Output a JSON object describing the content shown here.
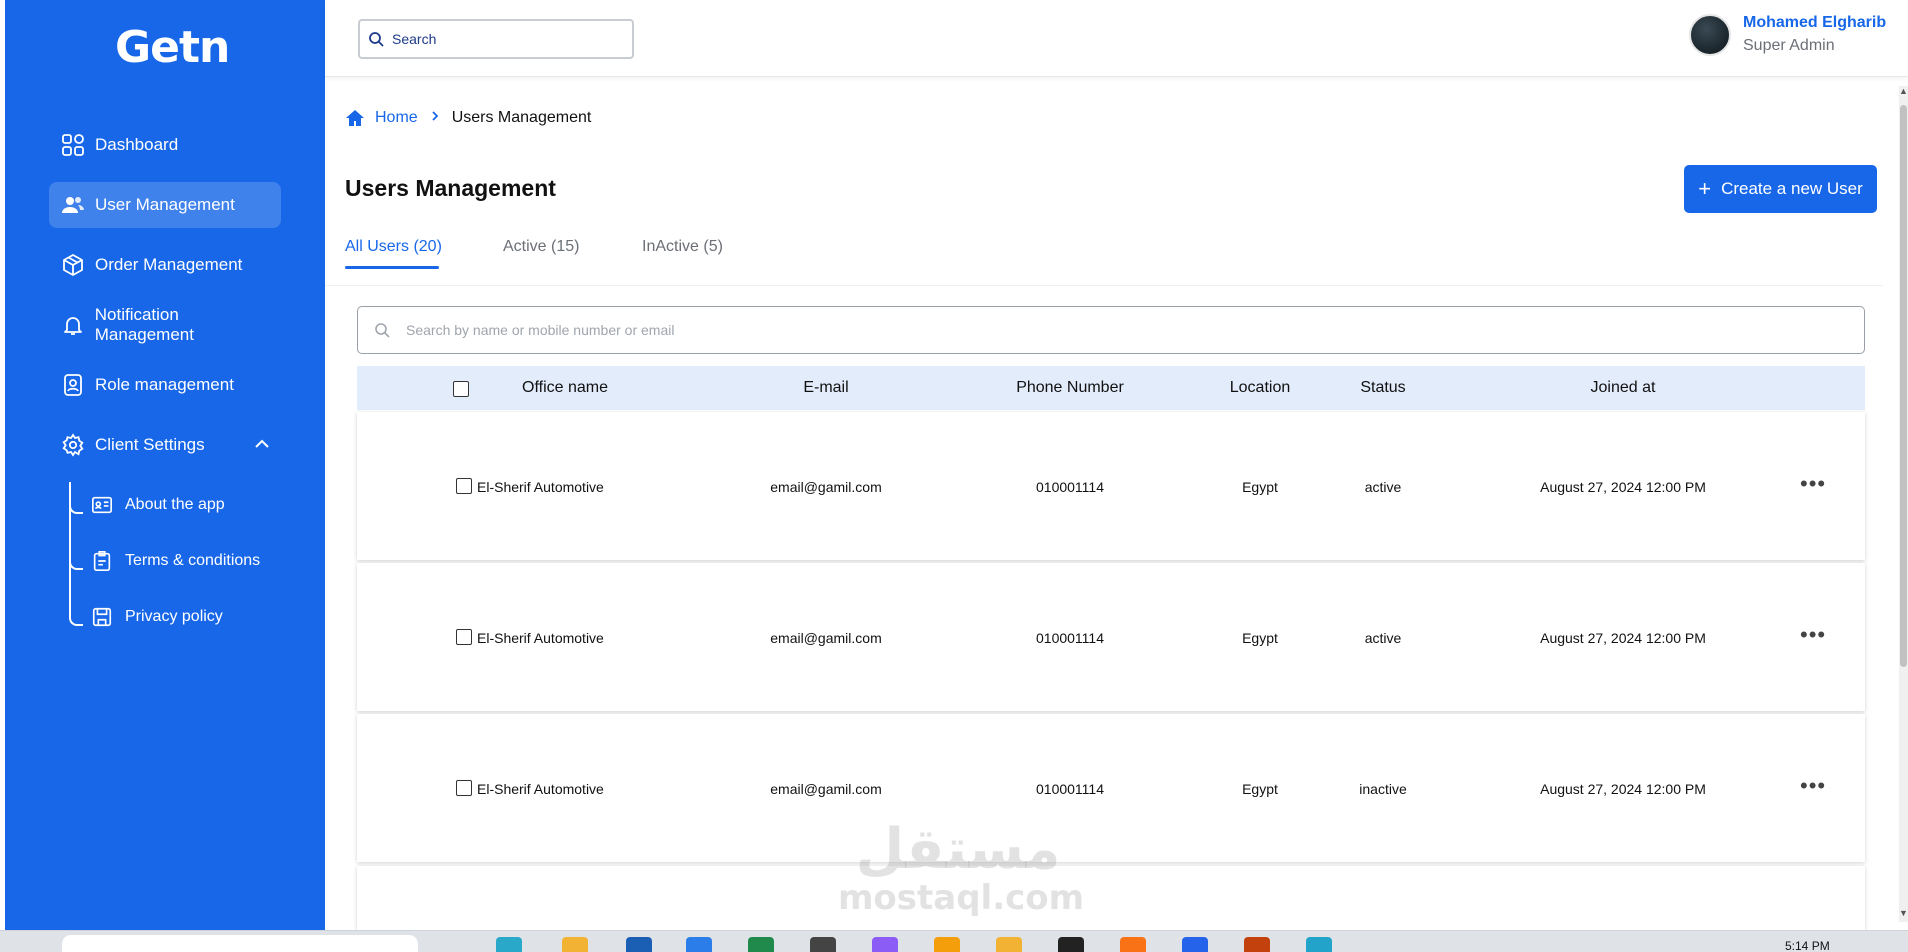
{
  "app": {
    "logo_text": "Getn"
  },
  "sidebar": {
    "items": [
      {
        "label": "Dashboard",
        "icon": "grid-icon"
      },
      {
        "label": "User Management",
        "icon": "users-icon",
        "active": true
      },
      {
        "label": "Order Management",
        "icon": "box-icon"
      },
      {
        "label": "Notification Management",
        "icon": "bell-icon"
      },
      {
        "label": "Role management",
        "icon": "id-badge-icon"
      },
      {
        "label": "Client Settings",
        "icon": "gear-icon",
        "expanded": true
      }
    ],
    "sub_items": [
      {
        "label": "About the app",
        "icon": "id-card-icon"
      },
      {
        "label": "Terms & conditions",
        "icon": "clipboard-icon"
      },
      {
        "label": "Privacy policy",
        "icon": "save-icon"
      }
    ]
  },
  "header": {
    "search_label": "Search",
    "user": {
      "name": "Mohamed Elgharib",
      "role": "Super Admin"
    }
  },
  "breadcrumb": {
    "home": "Home",
    "current": "Users Management"
  },
  "page": {
    "title": "Users Management",
    "create_button": "Create a new User"
  },
  "tabs": [
    {
      "label": "All Users (20)",
      "active": true
    },
    {
      "label": "Active (15)"
    },
    {
      "label": "InActive (5)"
    }
  ],
  "table": {
    "search_placeholder": "Search by name or mobile number or email",
    "columns": [
      "Office name",
      "E-mail",
      "Phone Number",
      "Location",
      "Status",
      "Joined at"
    ],
    "rows": [
      {
        "office": "El-Sherif Automotive",
        "email": "email@gamil.com",
        "phone": "010001114",
        "location": "Egypt",
        "status": "active",
        "joined": "August 27, 2024 12:00 PM"
      },
      {
        "office": "El-Sherif Automotive",
        "email": "email@gamil.com",
        "phone": "010001114",
        "location": "Egypt",
        "status": "active",
        "joined": "August 27, 2024 12:00 PM"
      },
      {
        "office": "El-Sherif Automotive",
        "email": "email@gamil.com",
        "phone": "010001114",
        "location": "Egypt",
        "status": "inactive",
        "joined": "August 27, 2024 12:00 PM"
      }
    ]
  },
  "watermark": {
    "arabic": "مستقل",
    "latin": "mostaql.com"
  },
  "taskbar": {
    "time": "5:14 PM"
  },
  "colors": {
    "primary": "#1767e8",
    "header_row": "#e3ecfb",
    "muted_text": "#6b6f76"
  }
}
